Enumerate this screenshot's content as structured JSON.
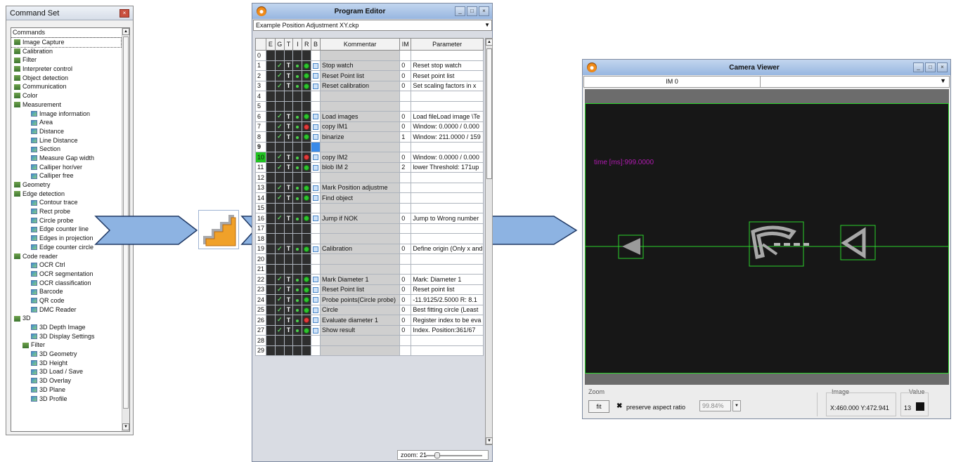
{
  "command_set": {
    "title": "Command Set",
    "close_glyph": "×",
    "header": "Commands",
    "items": [
      {
        "label": "Image Capture",
        "level": 0,
        "icon": "folder-icon"
      },
      {
        "label": "Calibration",
        "level": 0,
        "icon": "folder-icon"
      },
      {
        "label": "Filter",
        "level": 0,
        "icon": "folder-icon"
      },
      {
        "label": "Interpreter control",
        "level": 0,
        "icon": "folder-icon"
      },
      {
        "label": "Object detection",
        "level": 0,
        "icon": "folder-icon"
      },
      {
        "label": "Communication",
        "level": 0,
        "icon": "folder-icon"
      },
      {
        "label": "Color",
        "level": 0,
        "icon": "folder-icon"
      },
      {
        "label": "Measurement",
        "level": 0,
        "icon": "folder-icon"
      },
      {
        "label": "Image information",
        "level": 2,
        "icon": "command-icon"
      },
      {
        "label": "Area",
        "level": 2,
        "icon": "command-icon"
      },
      {
        "label": "Distance",
        "level": 2,
        "icon": "command-icon"
      },
      {
        "label": "Line Distance",
        "level": 2,
        "icon": "command-icon"
      },
      {
        "label": "Section",
        "level": 2,
        "icon": "command-icon"
      },
      {
        "label": "Measure Gap width",
        "level": 2,
        "icon": "command-icon"
      },
      {
        "label": "Calliper hor/ver",
        "level": 2,
        "icon": "command-icon"
      },
      {
        "label": "Calliper free",
        "level": 2,
        "icon": "command-icon"
      },
      {
        "label": "Geometry",
        "level": 0,
        "icon": "folder-icon"
      },
      {
        "label": "Edge detection",
        "level": 0,
        "icon": "folder-icon"
      },
      {
        "label": "Contour trace",
        "level": 2,
        "icon": "command-icon"
      },
      {
        "label": "Rect probe",
        "level": 2,
        "icon": "command-icon"
      },
      {
        "label": "Circle probe",
        "level": 2,
        "icon": "command-icon"
      },
      {
        "label": "Edge counter line",
        "level": 2,
        "icon": "command-icon"
      },
      {
        "label": "Edges in projection",
        "level": 2,
        "icon": "command-icon"
      },
      {
        "label": "Edge counter circle",
        "level": 2,
        "icon": "command-icon"
      },
      {
        "label": "Code reader",
        "level": 0,
        "icon": "folder-icon"
      },
      {
        "label": "OCR Ctrl",
        "level": 2,
        "icon": "command-icon"
      },
      {
        "label": "OCR segmentation",
        "level": 2,
        "icon": "command-icon"
      },
      {
        "label": "OCR classification",
        "level": 2,
        "icon": "command-icon"
      },
      {
        "label": "Barcode",
        "level": 2,
        "icon": "command-icon"
      },
      {
        "label": "QR code",
        "level": 2,
        "icon": "command-icon"
      },
      {
        "label": "DMC Reader",
        "level": 2,
        "icon": "command-icon"
      },
      {
        "label": "3D",
        "level": 0,
        "icon": "folder-icon"
      },
      {
        "label": "3D Depth Image",
        "level": 2,
        "icon": "command-icon"
      },
      {
        "label": "3D Display Settings",
        "level": 2,
        "icon": "command-icon"
      },
      {
        "label": "Filter",
        "level": 1,
        "icon": "folder-icon"
      },
      {
        "label": "3D Geometry",
        "level": 2,
        "icon": "command-icon"
      },
      {
        "label": "3D Height",
        "level": 2,
        "icon": "command-icon"
      },
      {
        "label": "3D Load / Save",
        "level": 2,
        "icon": "command-icon"
      },
      {
        "label": "3D Overlay",
        "level": 2,
        "icon": "command-icon"
      },
      {
        "label": "3D Plane",
        "level": 2,
        "icon": "command-icon"
      },
      {
        "label": "3D Profile",
        "level": 2,
        "icon": "command-icon"
      }
    ],
    "selected_index": 0
  },
  "program_editor": {
    "title": "Program Editor",
    "file": "Example Position Adjustment XY.ckp",
    "zoom_label": "zoom: 21",
    "columns": [
      "",
      "E",
      "G",
      "T",
      "I",
      "R",
      "B",
      "Kommentar",
      "IM",
      "Parameter"
    ],
    "rows": [
      {
        "n": "0",
        "en": false,
        "led": "",
        "icon": "",
        "comment": "",
        "im": "",
        "param": ""
      },
      {
        "n": "1",
        "en": true,
        "led": "green",
        "icon": "stopwatch-icon",
        "comment": "Stop watch",
        "im": "0",
        "param": "Reset stop watch"
      },
      {
        "n": "2",
        "en": true,
        "led": "green",
        "icon": "pointlist-icon",
        "comment": "Reset Point list",
        "im": "0",
        "param": "Reset point list"
      },
      {
        "n": "3",
        "en": true,
        "led": "green",
        "icon": "calibration-icon",
        "comment": "Reset calibration",
        "im": "0",
        "param": "Set scaling factors in x"
      },
      {
        "n": "4",
        "en": false,
        "led": "",
        "icon": "",
        "comment": "",
        "im": "",
        "param": ""
      },
      {
        "n": "5",
        "en": false,
        "led": "",
        "icon": "",
        "comment": "",
        "im": "",
        "param": ""
      },
      {
        "n": "6",
        "en": true,
        "led": "green",
        "icon": "load-images-icon",
        "comment": "Load images",
        "im": "0",
        "param": "Load fileLoad image \\Te"
      },
      {
        "n": "7",
        "en": true,
        "led": "red",
        "icon": "copy-icon",
        "comment": "copy IM1",
        "im": "0",
        "param": "Window: 0.0000 / 0.000"
      },
      {
        "n": "8",
        "en": true,
        "led": "green",
        "icon": "binarize-icon",
        "comment": "binarize",
        "im": "1",
        "param": "Window: 211.0000 / 159"
      },
      {
        "n": "9",
        "en": false,
        "led": "",
        "icon": "",
        "comment": "",
        "im": "",
        "param": "",
        "bold": true,
        "bblue": true
      },
      {
        "n": "10",
        "en": true,
        "led": "red",
        "icon": "copy-icon",
        "comment": "copy IM2",
        "im": "0",
        "param": "Window: 0.0000 / 0.000",
        "green": true
      },
      {
        "n": "11",
        "en": true,
        "led": "green",
        "icon": "blob-icon",
        "comment": "blob IM 2",
        "im": "2",
        "param": "lower Threshold: 171up"
      },
      {
        "n": "12",
        "en": false,
        "led": "",
        "icon": "",
        "comment": "",
        "im": "",
        "param": ""
      },
      {
        "n": "13",
        "en": true,
        "led": "green",
        "icon": "mark-position-icon",
        "comment": "Mark Position adjustme",
        "im": "",
        "param": ""
      },
      {
        "n": "14",
        "en": true,
        "led": "green",
        "icon": "find-object-icon",
        "comment": "Find object",
        "im": "",
        "param": ""
      },
      {
        "n": "15",
        "en": false,
        "led": "",
        "icon": "",
        "comment": "",
        "im": "",
        "param": ""
      },
      {
        "n": "16",
        "en": true,
        "led": "green",
        "icon": "jump-icon",
        "comment": "Jump if NOK",
        "im": "0",
        "param": "Jump to Wrong number"
      },
      {
        "n": "17",
        "en": false,
        "led": "",
        "icon": "",
        "comment": "",
        "im": "",
        "param": ""
      },
      {
        "n": "18",
        "en": false,
        "led": "",
        "icon": "",
        "comment": "",
        "im": "",
        "param": ""
      },
      {
        "n": "19",
        "en": true,
        "led": "green",
        "icon": "calibration-icon",
        "comment": "Calibration",
        "im": "0",
        "param": "Define origin (Only x and"
      },
      {
        "n": "20",
        "en": false,
        "led": "",
        "icon": "",
        "comment": "",
        "im": "",
        "param": ""
      },
      {
        "n": "21",
        "en": false,
        "led": "",
        "icon": "",
        "comment": "",
        "im": "",
        "param": ""
      },
      {
        "n": "22",
        "en": true,
        "led": "green",
        "icon": "mark-icon",
        "comment": "Mark Diameter 1",
        "im": "0",
        "param": "Mark: Diameter 1"
      },
      {
        "n": "23",
        "en": true,
        "led": "green",
        "icon": "pointlist-icon",
        "comment": "Reset Point list",
        "im": "0",
        "param": "Reset point list"
      },
      {
        "n": "24",
        "en": true,
        "led": "green",
        "icon": "probe-icon",
        "comment": "Probe points(Circle probe)",
        "im": "0",
        "param": "-11.9125/2.5000 R: 8.1"
      },
      {
        "n": "25",
        "en": true,
        "led": "green",
        "icon": "circle-icon",
        "comment": "Circle",
        "im": "0",
        "param": "Best fitting circle (Least"
      },
      {
        "n": "26",
        "en": true,
        "led": "red",
        "icon": "evaluate-icon",
        "comment": "Evaluate diameter 1",
        "im": "0",
        "param": "Register index to be eva"
      },
      {
        "n": "27",
        "en": true,
        "led": "green",
        "icon": "show-result-icon",
        "comment": "Show result",
        "im": "0",
        "param": "Index. Position:361/67"
      },
      {
        "n": "28",
        "en": false,
        "led": "",
        "icon": "",
        "comment": "",
        "im": "",
        "param": ""
      },
      {
        "n": "29",
        "en": false,
        "led": "",
        "icon": "",
        "comment": "",
        "im": "",
        "param": ""
      }
    ]
  },
  "camera_viewer": {
    "title": "Camera Viewer",
    "tab": "IM 0",
    "overlay_text": "time [ms]:999.0000",
    "zoom_group": "Zoom",
    "fit_label": "fit",
    "aspect_label": "preserve aspect ratio",
    "aspect_checked_glyph": "✖",
    "zoom_value": "99.84%",
    "image_group": "Image",
    "coords": "X:460.000  Y:472.941",
    "value_group": "Value",
    "value": "13"
  },
  "colors": {
    "arrow_fill": "#8db3e2",
    "arrow_border": "#1f3864",
    "overlay_green": "#2bd22b",
    "overlay_magenta": "#b01ab0"
  }
}
